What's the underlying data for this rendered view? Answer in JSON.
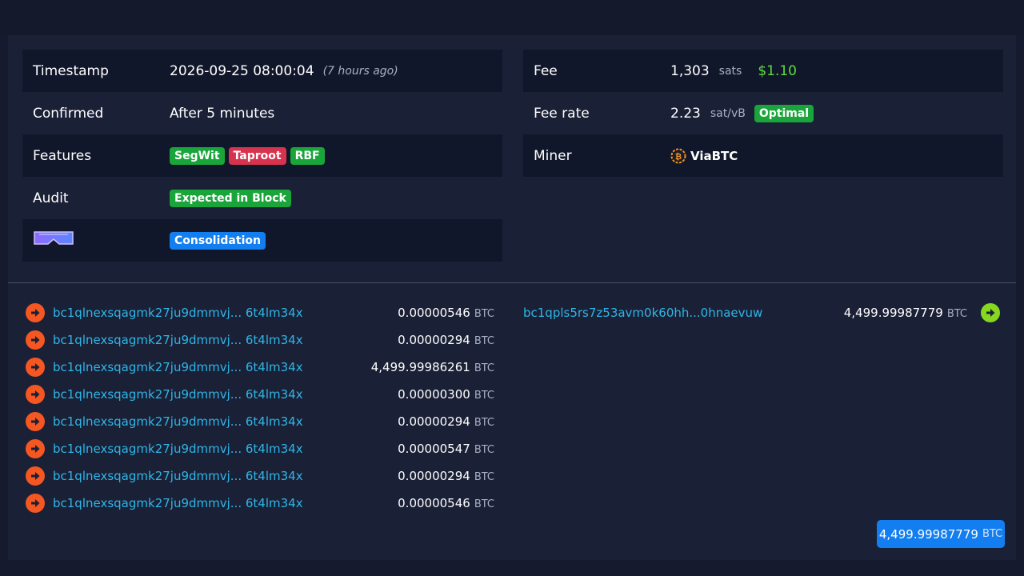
{
  "left_table": [
    {
      "label": "Timestamp",
      "value": "2026-09-25 08:00:04",
      "note": "(7 hours ago)"
    },
    {
      "label": "Confirmed",
      "value": "After 5 minutes"
    },
    {
      "label": "Features",
      "badges": [
        "SegWit",
        "Taproot",
        "RBF"
      ]
    },
    {
      "label": "Audit",
      "badge": "Expected in Block"
    },
    {
      "icon": "goggles-icon",
      "badge": "Consolidation"
    }
  ],
  "right_table": [
    {
      "label": "Fee",
      "value": "1,303",
      "unit": "sats",
      "usd": "$1.10"
    },
    {
      "label": "Fee rate",
      "value": "2.23",
      "unit": "sat/vB",
      "badge": "Optimal"
    },
    {
      "label": "Miner",
      "miner": "ViaBTC",
      "icon": "bitcoin-icon"
    }
  ],
  "inputs": [
    {
      "address": "bc1qlnexsqagmk27ju9dmmvj... 6t4lm34x",
      "amount": "0.00000546",
      "unit": "BTC"
    },
    {
      "address": "bc1qlnexsqagmk27ju9dmmvj... 6t4lm34x",
      "amount": "0.00000294",
      "unit": "BTC"
    },
    {
      "address": "bc1qlnexsqagmk27ju9dmmvj... 6t4lm34x",
      "amount": "4,499.99986261",
      "unit": "BTC"
    },
    {
      "address": "bc1qlnexsqagmk27ju9dmmvj... 6t4lm34x",
      "amount": "0.00000300",
      "unit": "BTC"
    },
    {
      "address": "bc1qlnexsqagmk27ju9dmmvj... 6t4lm34x",
      "amount": "0.00000294",
      "unit": "BTC"
    },
    {
      "address": "bc1qlnexsqagmk27ju9dmmvj... 6t4lm34x",
      "amount": "0.00000547",
      "unit": "BTC"
    },
    {
      "address": "bc1qlnexsqagmk27ju9dmmvj... 6t4lm34x",
      "amount": "0.00000294",
      "unit": "BTC"
    },
    {
      "address": "bc1qlnexsqagmk27ju9dmmvj... 6t4lm34x",
      "amount": "0.00000546",
      "unit": "BTC"
    }
  ],
  "outputs": [
    {
      "address": "bc1qpls5rs7z53avm0k60hh...0hnaevuw",
      "amount": "4,499.99987779",
      "unit": "BTC"
    }
  ],
  "total": {
    "amount": "4,499.99987779",
    "unit": "BTC"
  },
  "colors": {
    "input_icon": "#f45722",
    "output_icon": "#85d81f",
    "address": "#2eb6e8",
    "usd": "#5ddc3f",
    "badge_green": "#19a53a",
    "badge_red": "#d7334f",
    "badge_blue": "#137ef0"
  }
}
